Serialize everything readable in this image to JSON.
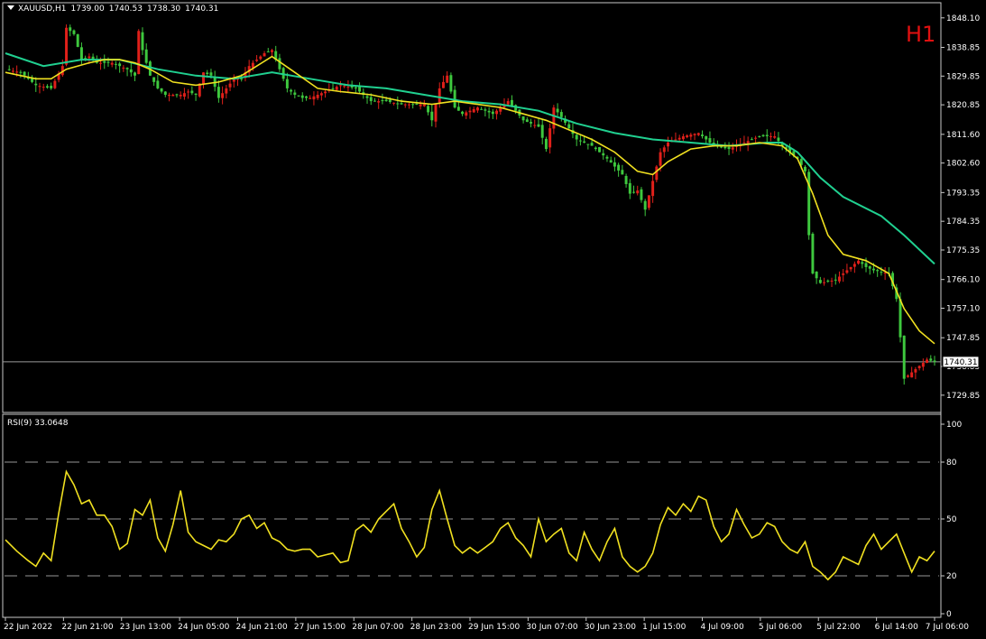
{
  "header": {
    "symbol": "XAUUSD,H1",
    "open": "1739.00",
    "high": "1740.53",
    "low": "1738.30",
    "close": "1740.31"
  },
  "timeframe_badge": "H1",
  "rsi_header": "RSI(9) 33.0648",
  "colors": {
    "bull": "#e0201a",
    "bear": "#3ec83e",
    "ma_fast": "#f0e020",
    "ma_slow": "#20d090",
    "rsi": "#f0e020",
    "grid": "#c8c8c8"
  },
  "chart_data": [
    {
      "type": "candlestick",
      "symbol": "XAUUSD",
      "timeframe": "H1",
      "ylim": [
        1725,
        1852
      ],
      "price_ticks": [
        "1848.10",
        "1838.85",
        "1829.85",
        "1820.85",
        "1811.60",
        "1802.60",
        "1793.35",
        "1784.35",
        "1775.35",
        "1766.10",
        "1757.10",
        "1747.85",
        "1738.85",
        "1729.85"
      ],
      "current_price": "1740.31",
      "time_labels": [
        "22 Jun 2022",
        "22 Jun 21:00",
        "23 Jun 13:00",
        "24 Jun 05:00",
        "24 Jun 21:00",
        "27 Jun 15:00",
        "28 Jun 07:00",
        "28 Jun 23:00",
        "29 Jun 15:00",
        "30 Jun 07:00",
        "30 Jun 23:00",
        "1 Jul 15:00",
        "4 Jul 09:00",
        "5 Jul 06:00",
        "5 Jul 22:00",
        "6 Jul 14:00",
        "7 Jul 06:00"
      ],
      "close_path": [
        [
          0,
          1832
        ],
        [
          4,
          1831
        ],
        [
          8,
          1827
        ],
        [
          12,
          1826
        ],
        [
          15,
          1833
        ],
        [
          16,
          1845
        ],
        [
          18,
          1843
        ],
        [
          20,
          1835
        ],
        [
          22,
          1836
        ],
        [
          24,
          1834
        ],
        [
          28,
          1834
        ],
        [
          30,
          1833
        ],
        [
          32,
          1832
        ],
        [
          34,
          1830
        ],
        [
          35,
          1844
        ],
        [
          36,
          1838
        ],
        [
          38,
          1830
        ],
        [
          40,
          1826
        ],
        [
          42,
          1824
        ],
        [
          44,
          1824
        ],
        [
          46,
          1824
        ],
        [
          48,
          1825
        ],
        [
          50,
          1824
        ],
        [
          52,
          1831
        ],
        [
          54,
          1830
        ],
        [
          56,
          1823
        ],
        [
          58,
          1826
        ],
        [
          60,
          1829
        ],
        [
          62,
          1829
        ],
        [
          64,
          1833
        ],
        [
          66,
          1835
        ],
        [
          68,
          1837
        ],
        [
          70,
          1838
        ],
        [
          72,
          1832
        ],
        [
          74,
          1826
        ],
        [
          76,
          1824
        ],
        [
          78,
          1823
        ],
        [
          80,
          1823
        ],
        [
          84,
          1825
        ],
        [
          88,
          1827
        ],
        [
          92,
          1826
        ],
        [
          96,
          1822
        ],
        [
          100,
          1822
        ],
        [
          104,
          1821
        ],
        [
          108,
          1821
        ],
        [
          110,
          1821
        ],
        [
          112,
          1816
        ],
        [
          114,
          1826
        ],
        [
          116,
          1830
        ],
        [
          118,
          1820
        ],
        [
          120,
          1818
        ],
        [
          124,
          1820
        ],
        [
          128,
          1818
        ],
        [
          132,
          1822
        ],
        [
          136,
          1816
        ],
        [
          140,
          1814
        ],
        [
          142,
          1807
        ],
        [
          144,
          1820
        ],
        [
          146,
          1817
        ],
        [
          150,
          1810
        ],
        [
          154,
          1808
        ],
        [
          158,
          1804
        ],
        [
          162,
          1799
        ],
        [
          164,
          1793
        ],
        [
          166,
          1794
        ],
        [
          168,
          1788
        ],
        [
          170,
          1797
        ],
        [
          172,
          1806
        ],
        [
          174,
          1809
        ],
        [
          178,
          1811
        ],
        [
          182,
          1812
        ],
        [
          186,
          1808
        ],
        [
          190,
          1807
        ],
        [
          194,
          1809
        ],
        [
          198,
          1811
        ],
        [
          202,
          1811
        ],
        [
          204,
          1808
        ],
        [
          206,
          1806
        ],
        [
          208,
          1804
        ],
        [
          210,
          1800
        ],
        [
          211,
          1780
        ],
        [
          212,
          1768
        ],
        [
          214,
          1765
        ],
        [
          218,
          1766
        ],
        [
          220,
          1768
        ],
        [
          224,
          1772
        ],
        [
          226,
          1770
        ],
        [
          228,
          1769
        ],
        [
          232,
          1768
        ],
        [
          234,
          1760
        ],
        [
          235,
          1748
        ],
        [
          236,
          1735
        ],
        [
          238,
          1737
        ],
        [
          240,
          1739
        ],
        [
          242,
          1741
        ],
        [
          244,
          1740.31
        ]
      ],
      "ma_fast": [
        [
          0,
          1831
        ],
        [
          8,
          1829
        ],
        [
          12,
          1829
        ],
        [
          16,
          1832
        ],
        [
          22,
          1834
        ],
        [
          26,
          1835
        ],
        [
          30,
          1835
        ],
        [
          34,
          1834
        ],
        [
          38,
          1832
        ],
        [
          44,
          1828
        ],
        [
          50,
          1827
        ],
        [
          56,
          1828
        ],
        [
          62,
          1830
        ],
        [
          70,
          1836
        ],
        [
          76,
          1831
        ],
        [
          82,
          1826
        ],
        [
          88,
          1825
        ],
        [
          96,
          1824
        ],
        [
          104,
          1822
        ],
        [
          112,
          1821
        ],
        [
          118,
          1822
        ],
        [
          124,
          1821
        ],
        [
          130,
          1820
        ],
        [
          136,
          1818
        ],
        [
          142,
          1816
        ],
        [
          148,
          1813
        ],
        [
          154,
          1810
        ],
        [
          160,
          1806
        ],
        [
          166,
          1800
        ],
        [
          170,
          1799
        ],
        [
          174,
          1803
        ],
        [
          180,
          1807
        ],
        [
          186,
          1808
        ],
        [
          192,
          1808
        ],
        [
          198,
          1809
        ],
        [
          204,
          1808
        ],
        [
          208,
          1804
        ],
        [
          212,
          1793
        ],
        [
          216,
          1780
        ],
        [
          220,
          1774
        ],
        [
          226,
          1772
        ],
        [
          232,
          1768
        ],
        [
          236,
          1757
        ],
        [
          240,
          1750
        ],
        [
          244,
          1746
        ]
      ],
      "ma_slow": [
        [
          0,
          1837
        ],
        [
          10,
          1833
        ],
        [
          20,
          1835
        ],
        [
          30,
          1835
        ],
        [
          40,
          1832
        ],
        [
          50,
          1830
        ],
        [
          60,
          1829
        ],
        [
          70,
          1831
        ],
        [
          80,
          1829
        ],
        [
          90,
          1827
        ],
        [
          100,
          1826
        ],
        [
          110,
          1824
        ],
        [
          120,
          1822
        ],
        [
          130,
          1821
        ],
        [
          140,
          1819
        ],
        [
          150,
          1815
        ],
        [
          160,
          1812
        ],
        [
          170,
          1810
        ],
        [
          180,
          1809
        ],
        [
          190,
          1808
        ],
        [
          200,
          1809
        ],
        [
          204,
          1809
        ],
        [
          208,
          1806
        ],
        [
          214,
          1798
        ],
        [
          220,
          1792
        ],
        [
          230,
          1786
        ],
        [
          236,
          1780
        ],
        [
          244,
          1771
        ]
      ]
    },
    {
      "type": "line",
      "name": "RSI(9) 33.0648",
      "ylim": [
        0,
        100
      ],
      "y_ticks": [
        "100",
        "80",
        "50",
        "20",
        "0"
      ],
      "levels": [
        80,
        50,
        20
      ],
      "values": [
        [
          0,
          39
        ],
        [
          3,
          33
        ],
        [
          6,
          28
        ],
        [
          8,
          25
        ],
        [
          10,
          32
        ],
        [
          12,
          28
        ],
        [
          14,
          53
        ],
        [
          16,
          75
        ],
        [
          18,
          68
        ],
        [
          20,
          58
        ],
        [
          22,
          60
        ],
        [
          24,
          52
        ],
        [
          26,
          52
        ],
        [
          28,
          46
        ],
        [
          30,
          34
        ],
        [
          32,
          37
        ],
        [
          34,
          55
        ],
        [
          36,
          52
        ],
        [
          38,
          60
        ],
        [
          40,
          40
        ],
        [
          42,
          33
        ],
        [
          44,
          47
        ],
        [
          46,
          65
        ],
        [
          48,
          43
        ],
        [
          50,
          38
        ],
        [
          52,
          36
        ],
        [
          54,
          34
        ],
        [
          56,
          39
        ],
        [
          58,
          38
        ],
        [
          60,
          42
        ],
        [
          62,
          50
        ],
        [
          64,
          52
        ],
        [
          66,
          45
        ],
        [
          68,
          48
        ],
        [
          70,
          40
        ],
        [
          72,
          38
        ],
        [
          74,
          34
        ],
        [
          76,
          33
        ],
        [
          78,
          34
        ],
        [
          80,
          34
        ],
        [
          82,
          30
        ],
        [
          84,
          31
        ],
        [
          86,
          32
        ],
        [
          88,
          27
        ],
        [
          90,
          28
        ],
        [
          92,
          44
        ],
        [
          94,
          47
        ],
        [
          96,
          43
        ],
        [
          98,
          50
        ],
        [
          100,
          54
        ],
        [
          102,
          58
        ],
        [
          104,
          45
        ],
        [
          106,
          38
        ],
        [
          108,
          30
        ],
        [
          110,
          35
        ],
        [
          112,
          55
        ],
        [
          114,
          65
        ],
        [
          116,
          50
        ],
        [
          118,
          36
        ],
        [
          120,
          32
        ],
        [
          122,
          35
        ],
        [
          124,
          32
        ],
        [
          126,
          35
        ],
        [
          128,
          38
        ],
        [
          130,
          45
        ],
        [
          132,
          48
        ],
        [
          134,
          40
        ],
        [
          136,
          36
        ],
        [
          138,
          30
        ],
        [
          140,
          50
        ],
        [
          142,
          38
        ],
        [
          144,
          42
        ],
        [
          146,
          45
        ],
        [
          148,
          32
        ],
        [
          150,
          28
        ],
        [
          152,
          43
        ],
        [
          154,
          34
        ],
        [
          156,
          28
        ],
        [
          158,
          38
        ],
        [
          160,
          45
        ],
        [
          162,
          30
        ],
        [
          164,
          25
        ],
        [
          166,
          22
        ],
        [
          168,
          25
        ],
        [
          170,
          32
        ],
        [
          172,
          47
        ],
        [
          174,
          56
        ],
        [
          176,
          52
        ],
        [
          178,
          58
        ],
        [
          180,
          54
        ],
        [
          182,
          62
        ],
        [
          184,
          60
        ],
        [
          186,
          46
        ],
        [
          188,
          38
        ],
        [
          190,
          42
        ],
        [
          192,
          55
        ],
        [
          194,
          47
        ],
        [
          196,
          40
        ],
        [
          198,
          42
        ],
        [
          200,
          48
        ],
        [
          202,
          46
        ],
        [
          204,
          38
        ],
        [
          206,
          34
        ],
        [
          208,
          32
        ],
        [
          210,
          38
        ],
        [
          212,
          25
        ],
        [
          214,
          22
        ],
        [
          216,
          18
        ],
        [
          218,
          22
        ],
        [
          220,
          30
        ],
        [
          222,
          28
        ],
        [
          224,
          26
        ],
        [
          226,
          36
        ],
        [
          228,
          42
        ],
        [
          230,
          34
        ],
        [
          232,
          38
        ],
        [
          234,
          42
        ],
        [
          236,
          32
        ],
        [
          238,
          22
        ],
        [
          240,
          30
        ],
        [
          242,
          28
        ],
        [
          244,
          33.06
        ]
      ]
    }
  ]
}
